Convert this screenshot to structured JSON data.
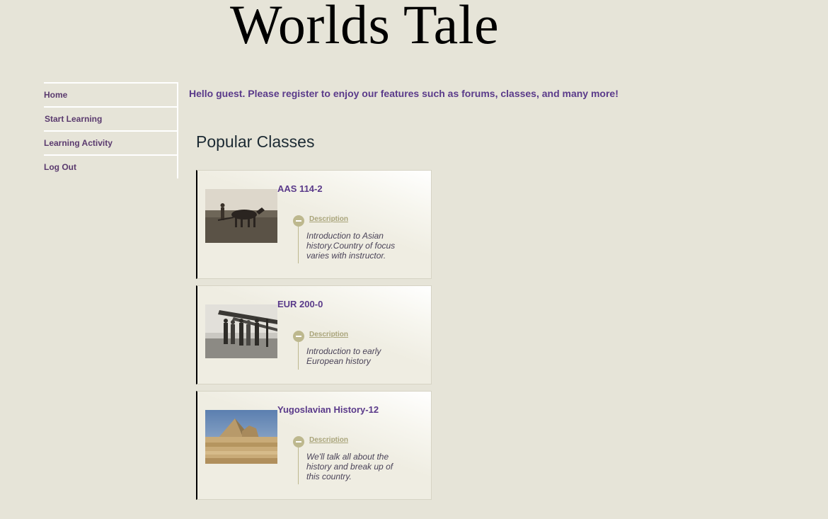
{
  "site": {
    "title": "Worlds Tale"
  },
  "nav": {
    "items": [
      {
        "label": "Home"
      },
      {
        "label": "Start Learning"
      },
      {
        "label": "Learning Activity"
      },
      {
        "label": "Log Out"
      }
    ]
  },
  "welcome": {
    "text": "Hello guest. Please register to enjoy our features such as forums, classes, and many more!"
  },
  "popular": {
    "title": "Popular Classes",
    "classes": [
      {
        "name": "AAS 114-2",
        "desc_label": "Description",
        "description": "Introduction to Asian history.Country of focus varies with instructor.",
        "image_icon": "plowing-horses-photo"
      },
      {
        "name": "EUR 200-0",
        "desc_label": "Description",
        "description": "Introduction to early European history",
        "image_icon": "biplane-crew-photo"
      },
      {
        "name": "Yugoslavian History-12",
        "desc_label": "Description",
        "description": "We'll talk all about the history and break up of this country.",
        "image_icon": "pyramid-sphinx-photo"
      }
    ]
  },
  "colors": {
    "background": "#e6e4d8",
    "link_purple": "#5a3a8a",
    "accent_khaki": "#bdb88e"
  }
}
